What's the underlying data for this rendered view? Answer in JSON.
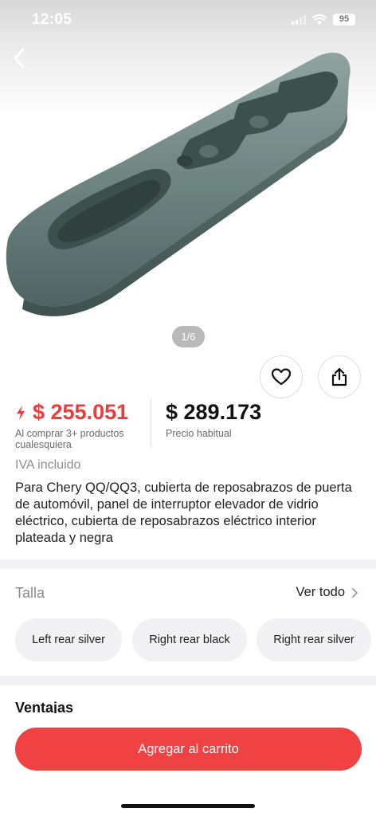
{
  "status_bar": {
    "time": "12:05",
    "battery": "95"
  },
  "gallery": {
    "counter": "1/6"
  },
  "prices": {
    "promo_price": "$ 255.051",
    "promo_note": "Al comprar 3+ productos cualesquiera",
    "regular_price": "$ 289.173",
    "regular_note": "Precio habitual",
    "tax_note": "IVA incluido"
  },
  "product": {
    "title": "Para Chery QQ/QQ3, cubierta de reposabrazos de puerta de automóvil, panel de interruptor elevador de vidrio eléctrico, cubierta de reposabrazos eléctrico interior plateada y negra"
  },
  "size": {
    "label": "Talla",
    "see_all": "Ver todo",
    "options": [
      "Left rear silver",
      "Right rear black",
      "Right rear silver"
    ]
  },
  "advantages_heading": "Ventajas",
  "actions": {
    "add_to_cart": "Agregar al carrito"
  },
  "colors": {
    "accent": "#f04143",
    "price_red": "#ec3b3d"
  },
  "icons": [
    "back-arrow-icon",
    "heart-icon",
    "share-icon",
    "bolt-icon",
    "chevron-right-icon"
  ]
}
